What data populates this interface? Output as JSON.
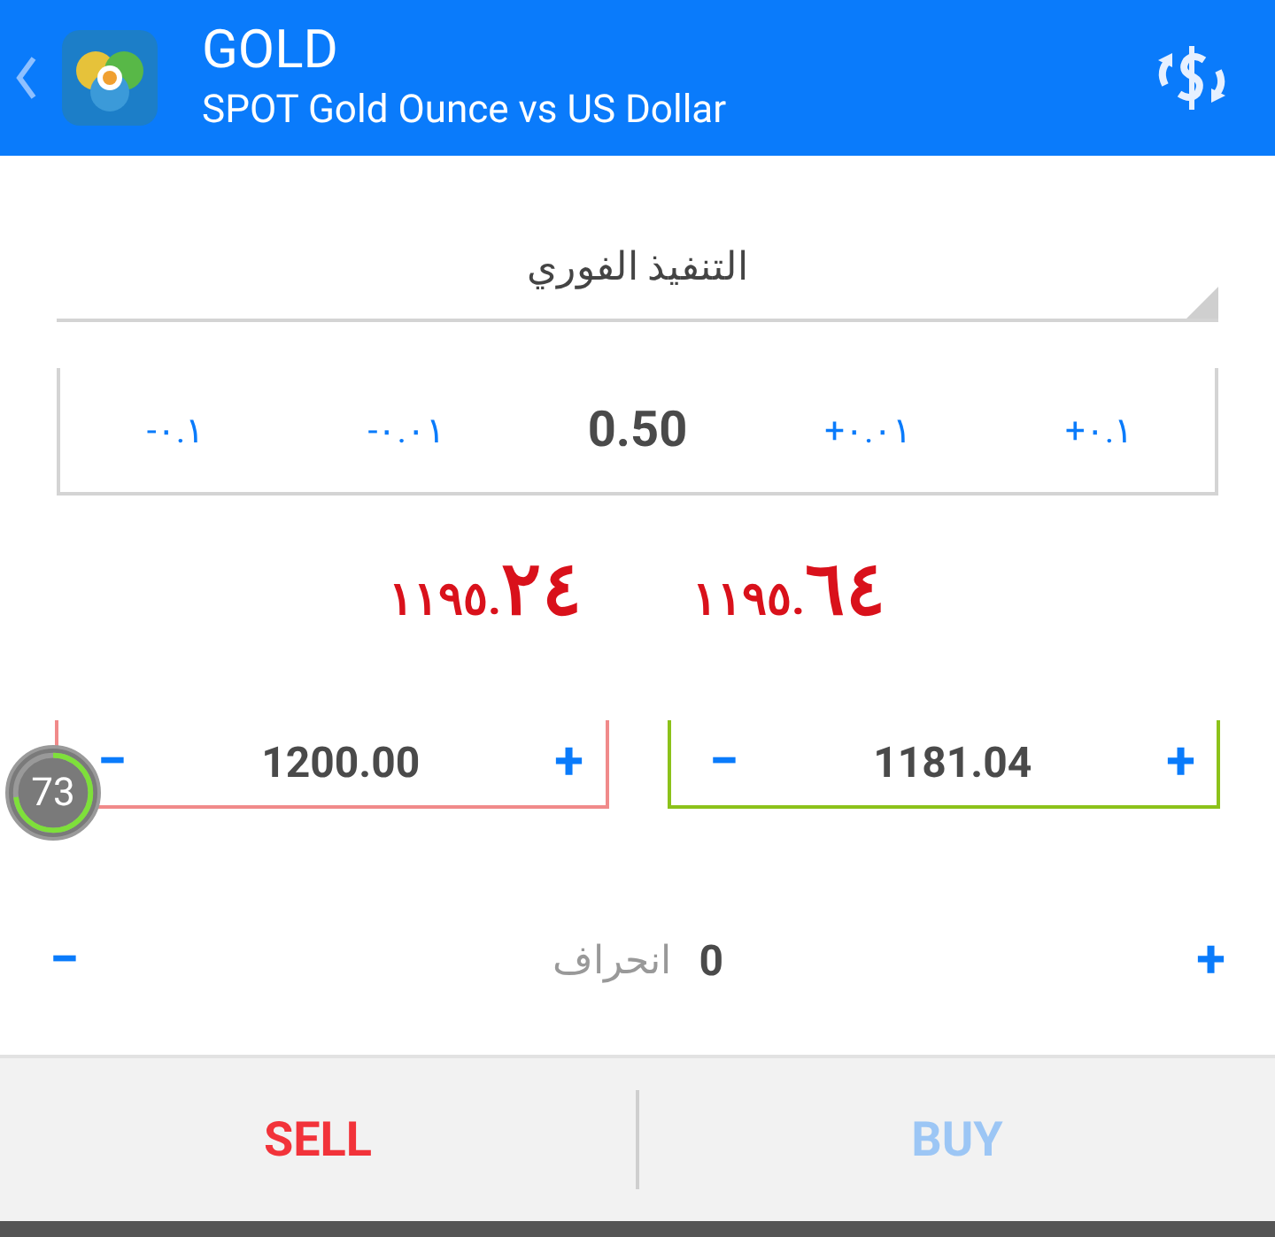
{
  "header": {
    "title": "GOLD",
    "subtitle": "SPOT Gold Ounce vs US Dollar"
  },
  "order_type": {
    "value": "التنفيذ الفوري"
  },
  "volume": {
    "steps": [
      "+٠.١",
      "+٠.٠١",
      "-٠.٠١",
      "-٠.١"
    ],
    "value": "0.50"
  },
  "prices": [
    {
      "base": "١١٩٥.",
      "pips": "٦٤"
    },
    {
      "base": "١١٩٥.",
      "pips": "٢٤"
    }
  ],
  "levels": [
    {
      "kind": "take_profit",
      "value": "1181.04",
      "minus": "−",
      "plus": "+"
    },
    {
      "kind": "stop_loss",
      "value": "1200.00",
      "minus": "−",
      "plus": "+"
    }
  ],
  "deviation": {
    "label": "انحراف",
    "value": "0",
    "minus": "−",
    "plus": "+"
  },
  "gauge": {
    "value": "73",
    "level": 0.73
  },
  "actions": [
    {
      "kind": "buy",
      "label": "BUY"
    },
    {
      "kind": "sell",
      "label": "SELL"
    }
  ]
}
